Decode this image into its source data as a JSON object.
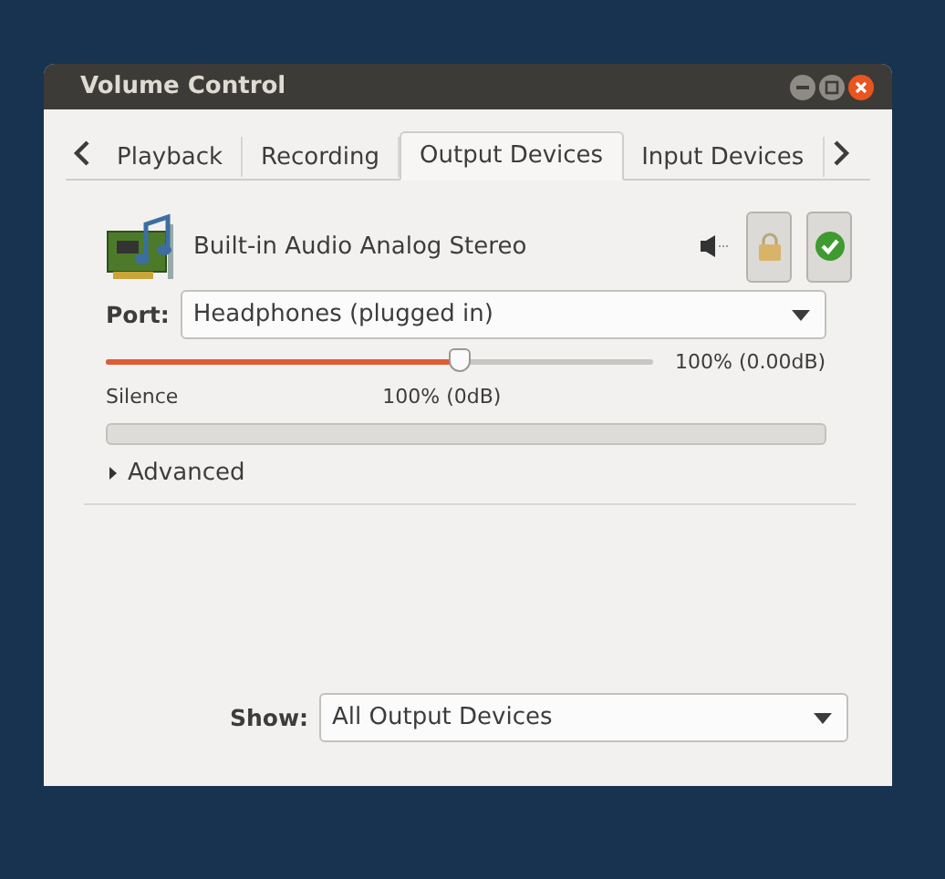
{
  "window": {
    "title": "Volume Control"
  },
  "tabs": [
    {
      "label": "Playback",
      "selected": false
    },
    {
      "label": "Recording",
      "selected": false
    },
    {
      "label": "Output Devices",
      "selected": true
    },
    {
      "label": "Input Devices",
      "selected": false
    }
  ],
  "device": {
    "name": "Built-in Audio Analog Stereo",
    "muted": false,
    "locked": true,
    "default": true,
    "port_label": "Port:",
    "port": "Headphones (plugged in)",
    "volume": {
      "level": 0.65,
      "reading": "100% (0.00dB)",
      "min_label": "Silence",
      "mark_label": "100% (0dB)"
    },
    "advanced": {
      "label": "Advanced",
      "expanded": false
    }
  },
  "show": {
    "label": "Show:",
    "value": "All Output Devices"
  }
}
